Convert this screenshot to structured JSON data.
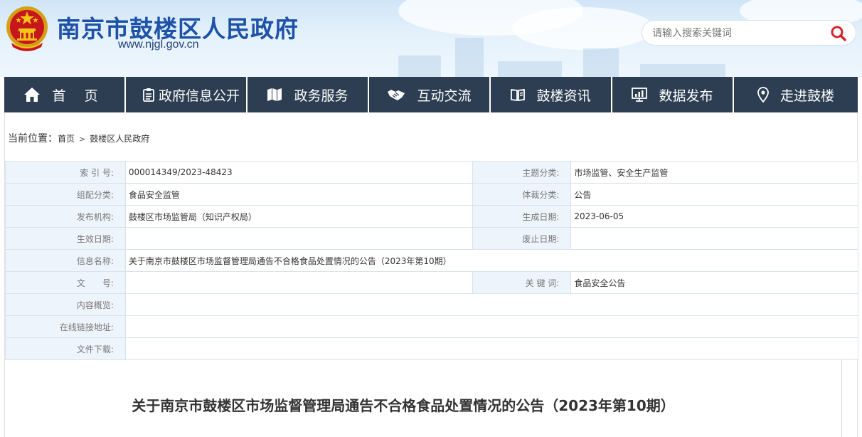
{
  "header": {
    "site_title": "南京市鼓楼区人民政府",
    "site_url": "www.njgl.gov.cn",
    "search_placeholder": "请输入搜索关键词",
    "emblem_icon": "national-emblem-icon",
    "search_icon": "search-icon"
  },
  "nav": {
    "items": [
      {
        "label": "首 页",
        "icon": "home-icon"
      },
      {
        "label": "政府信息公开",
        "icon": "document-icon"
      },
      {
        "label": "政务服务",
        "icon": "map-icon"
      },
      {
        "label": "互动交流",
        "icon": "handshake-icon"
      },
      {
        "label": "鼓楼资讯",
        "icon": "book-icon"
      },
      {
        "label": "数据发布",
        "icon": "chart-screen-icon"
      },
      {
        "label": "走进鼓楼",
        "icon": "location-pin-icon"
      }
    ]
  },
  "breadcrumb": {
    "label": "当前位置：",
    "items": [
      "首页",
      "鼓楼区人民政府"
    ],
    "separator": ">"
  },
  "meta": {
    "index_no_label": "索 引 号:",
    "index_no": "000014349/2023-48423",
    "topic_label": "主题分类:",
    "topic": "市场监管、安全生产监管",
    "org_cat_label": "组配分类:",
    "org_cat": "食品安全监管",
    "genre_label": "体裁分类:",
    "genre": "公告",
    "publisher_label": "发布机构:",
    "publisher": "鼓楼区市场监管局（知识产权局）",
    "created_label": "生成日期:",
    "created": "2023-06-05",
    "effective_label": "生效日期:",
    "effective": "",
    "expire_label": "废止日期:",
    "expire": "",
    "name_label": "信息名称:",
    "name": "关于南京市鼓楼区市场监督管理局通告不合格食品处置情况的公告（2023年第10期）",
    "doc_no_label": "文　　号:",
    "doc_no": "",
    "keywords_label": "关 键 词:",
    "keywords": "食品安全公告",
    "summary_label": "内容概览:",
    "summary": "",
    "link_label": "在线链接地址:",
    "link": "",
    "download_label": "文件下载:",
    "download": ""
  },
  "article": {
    "title": "关于南京市鼓楼区市场监督管理局通告不合格食品处置情况的公告（2023年第10期）"
  },
  "colors": {
    "nav_bg": "#2d3e52",
    "title_blue": "#1d52a8",
    "label_cell_bg": "#eef4fb",
    "search_icon_red": "#d7242b"
  }
}
